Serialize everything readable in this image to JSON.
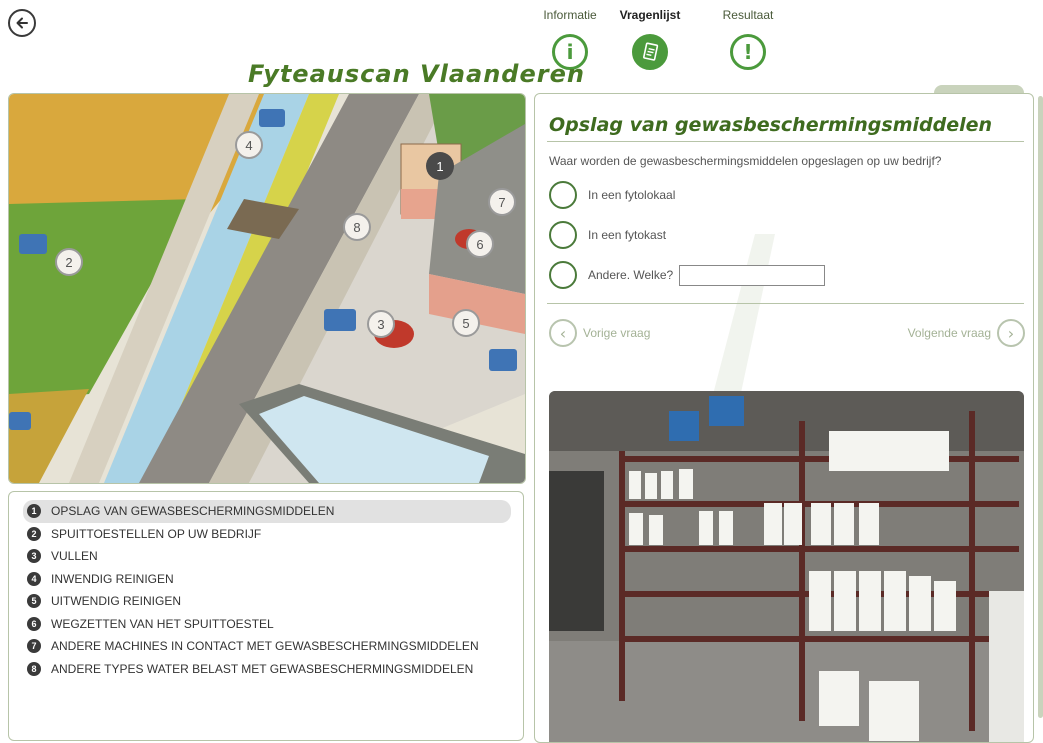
{
  "nav": {
    "tabs": [
      {
        "label": "Informatie",
        "icon": "info-icon",
        "glyph": "i",
        "active": false
      },
      {
        "label": "Vragenlijst",
        "icon": "questionnaire-icon",
        "active": true
      },
      {
        "label": "Resultaat",
        "icon": "exclamation-icon",
        "glyph": "!",
        "active": false
      }
    ]
  },
  "brand": {
    "title": "Fyteauscan Vlaanderen",
    "color": "#4a7a26"
  },
  "map": {
    "markers": [
      "1",
      "2",
      "3",
      "4",
      "5",
      "6",
      "7",
      "8"
    ]
  },
  "topics": [
    {
      "num": "1",
      "label": "OPSLAG VAN GEWASBESCHERMINGSMIDDELEN",
      "active": true
    },
    {
      "num": "2",
      "label": "SPUITTOESTELLEN OP UW BEDRIJF"
    },
    {
      "num": "3",
      "label": "VULLEN"
    },
    {
      "num": "4",
      "label": "INWENDIG REINIGEN"
    },
    {
      "num": "5",
      "label": "UITWENDIG REINIGEN"
    },
    {
      "num": "6",
      "label": "WEGZETTEN VAN HET SPUITTOESTEL"
    },
    {
      "num": "7",
      "label": "ANDERE MACHINES IN CONTACT MET GEWASBESCHERMINGSMIDDELEN"
    },
    {
      "num": "8",
      "label": "ANDERE TYPES WATER BELAST MET GEWASBESCHERMINGSMIDDELEN"
    }
  ],
  "question": {
    "title": "Opslag van gewasbeschermingsmiddelen",
    "text": "Waar worden de gewasbeschermingsmiddelen opgeslagen op uw bedrijf?",
    "options": [
      {
        "label": "In een fytolokaal"
      },
      {
        "label": "In een fytokast"
      },
      {
        "label": "Andere. Welke?",
        "input_value": ""
      }
    ],
    "prev_label": "Vorige vraag",
    "next_label": "Volgende vraag"
  },
  "colors": {
    "accent": "#4b9a3c",
    "title_green": "#3e6b1f",
    "border": "#b7c4a8"
  }
}
